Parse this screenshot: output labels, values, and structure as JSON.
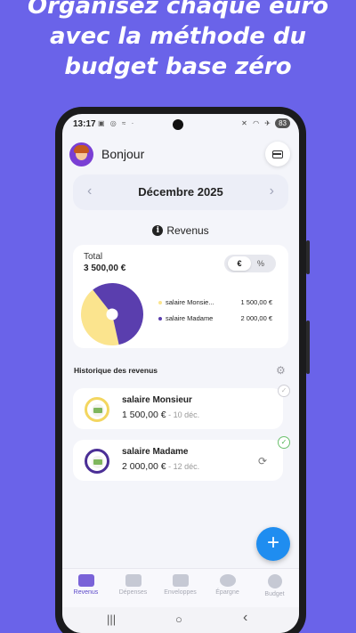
{
  "headline": {
    "line1": "Organisez chaque euro",
    "line2": "avec la méthode du",
    "line3": "budget base zéro"
  },
  "status": {
    "time": "13:17",
    "battery": "83"
  },
  "header": {
    "greeting": "Bonjour",
    "avatar_icon": "boy-avatar-icon",
    "wallet_icon": "credit-card-icon"
  },
  "month": {
    "label": "Décembre 2025",
    "prev": "‹",
    "next": "›"
  },
  "section": {
    "title": "Revenus"
  },
  "summary": {
    "total_label": "Total",
    "total_value": "3 500,00 €",
    "toggle": [
      "€",
      "%"
    ],
    "toggle_selected": "€",
    "legend": [
      {
        "name": "salaire Monsie...",
        "amount": "1 500,00 €",
        "color": "#fbe48e"
      },
      {
        "name": "salaire Madame",
        "amount": "2 000,00 €",
        "color": "#5a3eae"
      }
    ]
  },
  "chart_data": {
    "type": "pie",
    "categories": [
      "salaire Monsieur",
      "salaire Madame"
    ],
    "values": [
      1500,
      2000
    ],
    "colors": [
      "#fbe48e",
      "#5a3eae"
    ]
  },
  "history": {
    "title": "Historique des revenus",
    "rows": [
      {
        "name": "salaire Monsieur",
        "amount": "1 500,00 €",
        "date": " - 10 déc.",
        "ring_color": "#f3d660"
      },
      {
        "name": "salaire Madame",
        "amount": "2 000,00 €",
        "date": " - 12 déc.",
        "ring_color": "#4b2f96"
      }
    ]
  },
  "fab": {
    "label": "+"
  },
  "tabs": [
    "Revenus",
    "Dépenses",
    "Enveloppes",
    "Épargne",
    "Budget"
  ],
  "tab_active": "Revenus",
  "navbar": {
    "recents": "|||",
    "home": "○",
    "back": "‹"
  }
}
